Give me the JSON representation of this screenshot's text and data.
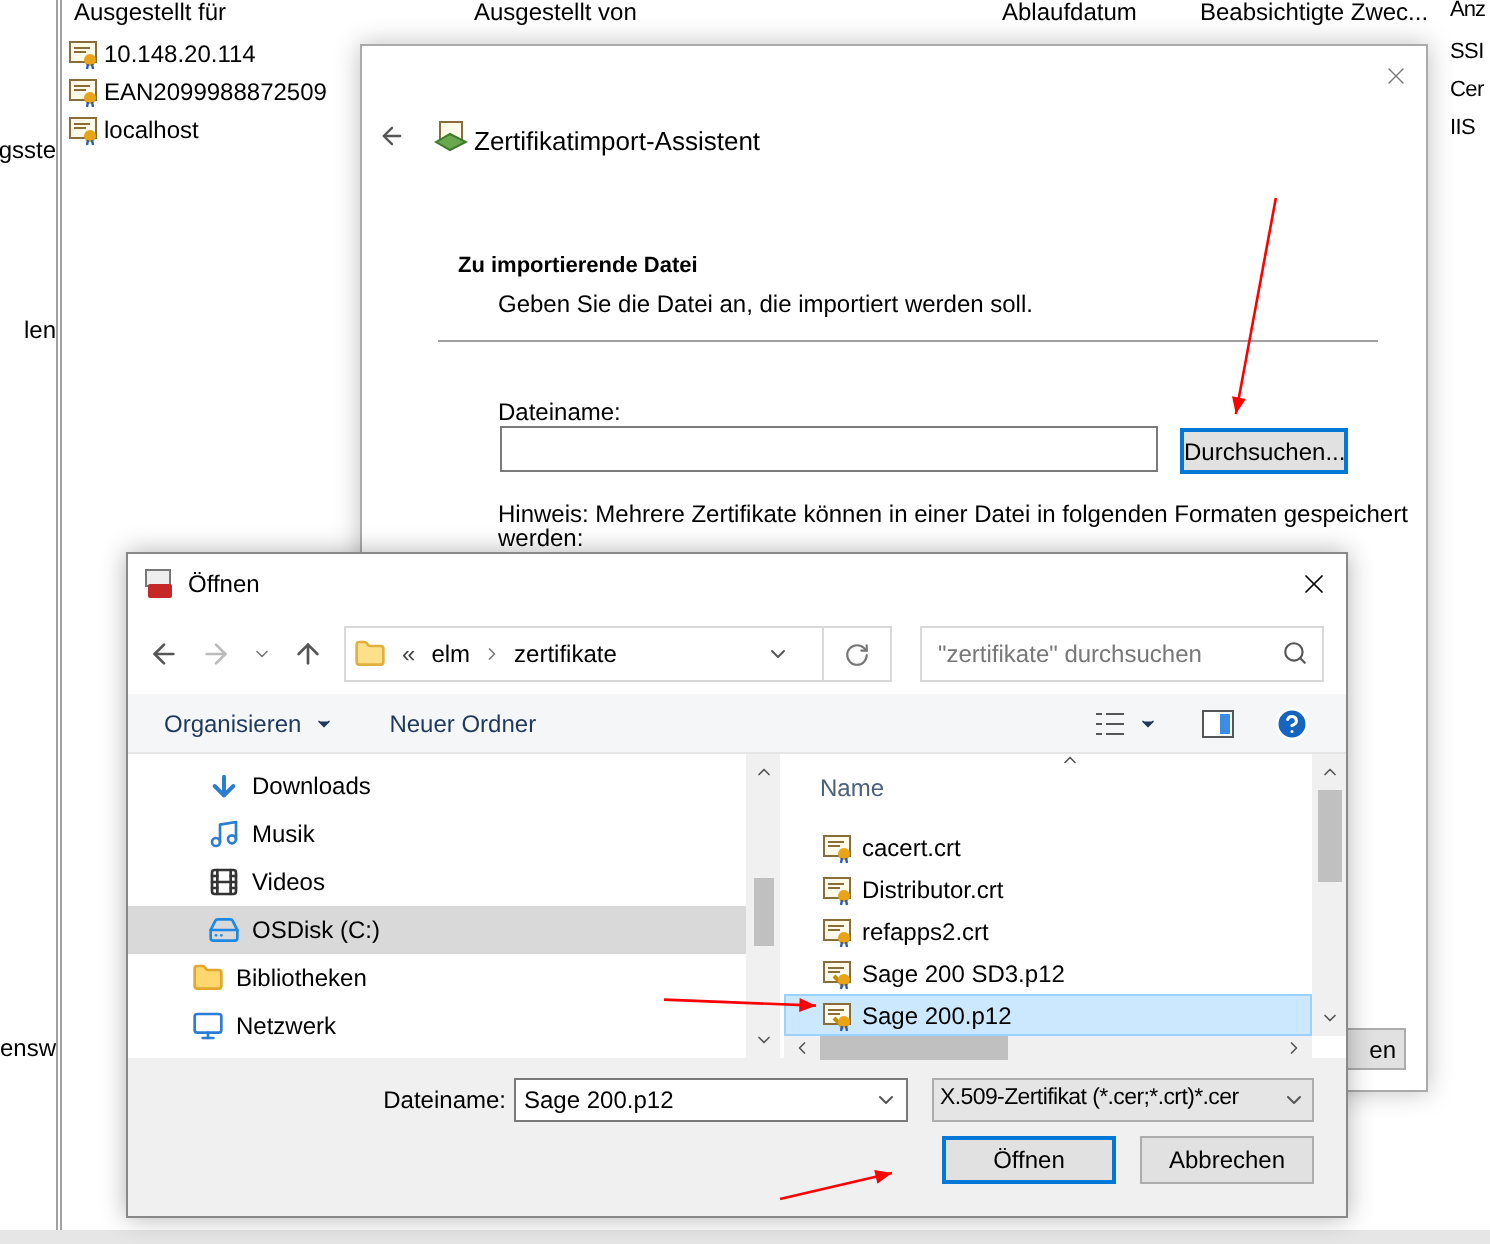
{
  "console": {
    "left_pane_items": [
      "gsste",
      "len",
      "ensw"
    ],
    "columns": [
      "Ausgestellt für",
      "Ausgestellt von",
      "Ablaufdatum",
      "Beabsichtigte Zwec...",
      "Anz"
    ],
    "rows": [
      {
        "name": "10.148.20.114",
        "purpose": "SSI"
      },
      {
        "name": "EAN2099988872509",
        "purpose": "Cer"
      },
      {
        "name": "localhost",
        "purpose": "IIS"
      }
    ]
  },
  "wizard": {
    "title": "Zertifikatimport-Assistent",
    "heading": "Zu importierende Datei",
    "subheading": "Geben Sie die Datei an, die importiert werden soll.",
    "file_label": "Dateiname:",
    "browse_button": "Durchsuchen...",
    "hint": "Hinweis: Mehrere Zertifikate können in einer Datei in folgenden Formaten gespeichert",
    "hint_cut": "werden:",
    "next_button_cut": "en"
  },
  "open_dialog": {
    "title": "Öffnen",
    "path": [
      "«",
      "elm",
      "zertifikate"
    ],
    "search": {
      "placeholder": "\"zertifikate\" durchsuchen"
    },
    "toolbar": {
      "organize": "Organisieren",
      "new_folder": "Neuer Ordner"
    },
    "tree": [
      {
        "label": "Downloads",
        "kind": "download",
        "selected": false
      },
      {
        "label": "Musik",
        "kind": "music",
        "selected": false
      },
      {
        "label": "Videos",
        "kind": "video",
        "selected": false
      },
      {
        "label": "OSDisk (C:)",
        "kind": "drive",
        "selected": true
      },
      {
        "label": "Bibliotheken",
        "kind": "library",
        "selected": false
      },
      {
        "label": "Netzwerk",
        "kind": "network",
        "selected": false
      }
    ],
    "column_header": "Name",
    "files": [
      {
        "name": "cacert.crt",
        "kind": "crt",
        "selected": false
      },
      {
        "name": "Distributor.crt",
        "kind": "crt",
        "selected": false
      },
      {
        "name": "refapps2.crt",
        "kind": "crt",
        "selected": false
      },
      {
        "name": "Sage 200 SD3.p12",
        "kind": "p12",
        "selected": false
      },
      {
        "name": "Sage 200.p12",
        "kind": "p12",
        "selected": true
      }
    ],
    "file_name_label": "Dateiname:",
    "file_name_value": "Sage 200.p12",
    "file_type": "X.509-Zertifikat (*.cer;*.crt)*.cer",
    "buttons": [
      {
        "label": "Öffnen",
        "kind": "primary"
      },
      {
        "label": "Abbrechen",
        "kind": "secondary"
      }
    ]
  }
}
